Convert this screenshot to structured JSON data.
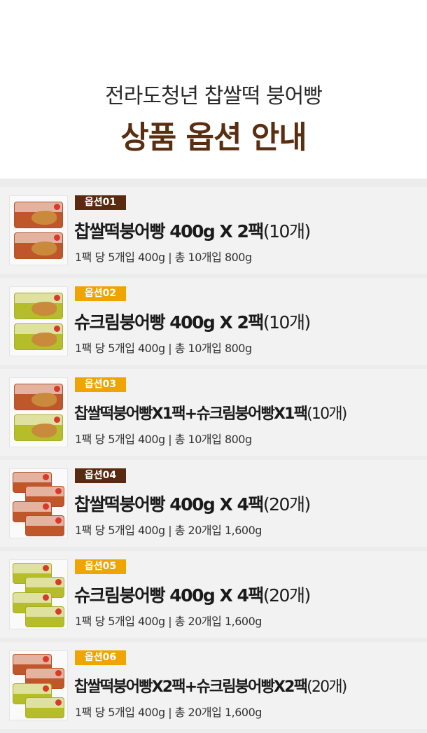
{
  "header": {
    "subtitle": "전라도청년 찹쌀떡 붕어빵",
    "title": "상품 옵션 안내"
  },
  "options": [
    {
      "badge": "옵션01",
      "badge_color": "#5a2a10",
      "name": "찹쌀떡붕어빵 400g X 2팩",
      "qty": "(10개)",
      "desc": "1팩 당 5개입 400g  |  총 10개입 800g",
      "image": "red-pack-x2"
    },
    {
      "badge": "옵션02",
      "badge_color": "#f0a400",
      "name": "슈크림붕어빵 400g X 2팩",
      "qty": "(10개)",
      "desc": "1팩 당 5개입 400g  |  총 10개입 800g",
      "image": "green-pack-x2"
    },
    {
      "badge": "옵션03",
      "badge_color": "#f0a400",
      "name": "찹쌀떡붕어빵X1팩+슈크림붕어빵X1팩",
      "qty": "(10개)",
      "desc": "1팩 당 5개입 400g  |  총 10개입 800g",
      "image": "red-green-pack"
    },
    {
      "badge": "옵션04",
      "badge_color": "#5a2a10",
      "name": "찹쌀떡붕어빵 400g X 4팩",
      "qty": "(20개)",
      "desc": "1팩 당 5개입 400g  |  총 20개입 1,600g",
      "image": "red-pack-x4"
    },
    {
      "badge": "옵션05",
      "badge_color": "#f0a400",
      "name": "슈크림붕어빵 400g X 4팩",
      "qty": "(20개)",
      "desc": "1팩 당 5개입 400g  |  총 20개입 1,600g",
      "image": "green-pack-x4"
    },
    {
      "badge": "옵션06",
      "badge_color": "#f0a400",
      "name": "찹쌀떡붕어빵X2팩+슈크림붕어빵X2팩",
      "qty": "(20개)",
      "desc": "1팩 당 5개입 400g  |  총 20개입 1,600g",
      "image": "red-green-pack-x4"
    }
  ]
}
